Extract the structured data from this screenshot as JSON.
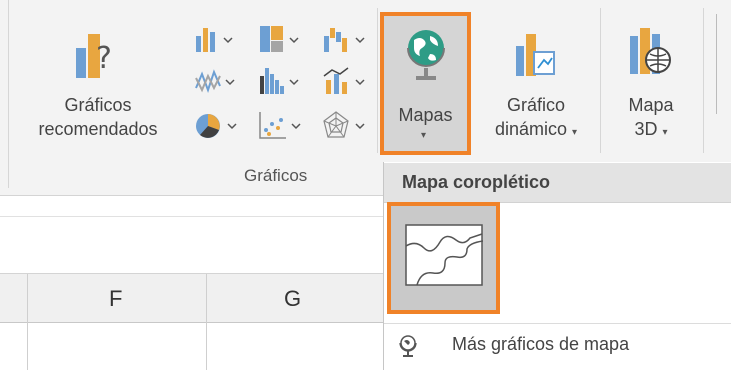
{
  "ribbon": {
    "recommended_charts": {
      "line1": "Gráficos",
      "line2": "recomendados"
    },
    "group_label": "Gráficos",
    "maps": {
      "label": "Mapas",
      "caret": "▾"
    },
    "pivot_chart": {
      "line1": "Gráfico",
      "line2": "dinámico",
      "caret": "▾"
    },
    "map3d": {
      "line1": "Mapa",
      "line2": "3D",
      "caret": "▾"
    },
    "small_chart_icons": [
      "column-chart",
      "hierarchy-chart",
      "waterfall-chart",
      "line-chart",
      "statistic-chart",
      "combo-chart",
      "pie-chart",
      "scatter-chart",
      "radar-chart"
    ]
  },
  "dropdown": {
    "header": "Mapa coroplético",
    "choropleth_tile": "filled-map",
    "more_maps_label": "Más gráficos de mapa"
  },
  "sheet": {
    "columns": [
      "F",
      "G"
    ]
  },
  "colors": {
    "highlight": "#f08228",
    "ribbon_bg": "#f3f3f3",
    "button_active": "#d5d5d5"
  }
}
